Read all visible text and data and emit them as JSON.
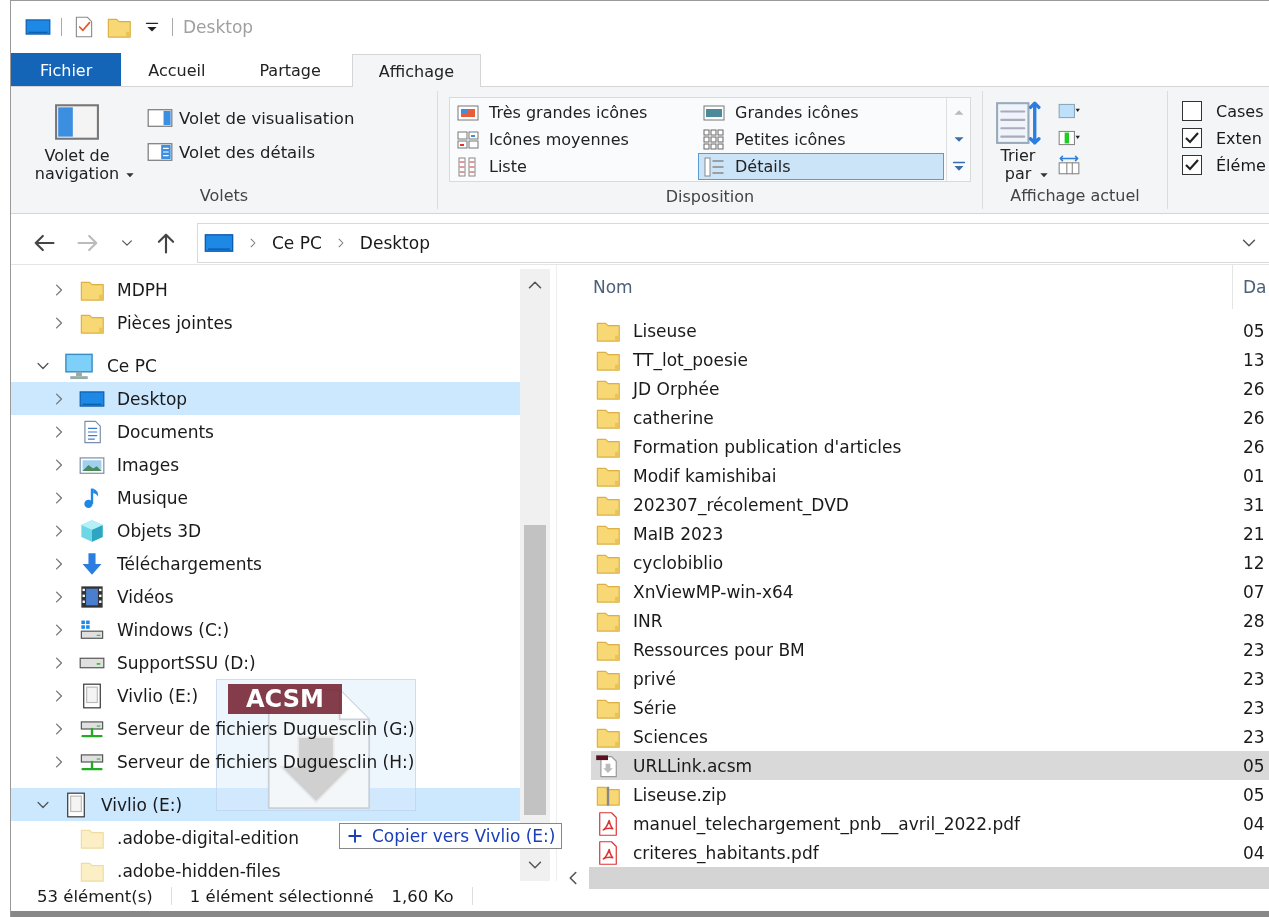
{
  "quick_access": {
    "title": "Desktop"
  },
  "ribbon_tabs": [
    {
      "label": "Fichier",
      "kind": "file",
      "selected": false
    },
    {
      "label": "Accueil",
      "kind": "tab",
      "selected": false
    },
    {
      "label": "Partage",
      "kind": "tab",
      "selected": false
    },
    {
      "label": "Affichage",
      "kind": "tab",
      "selected": true
    }
  ],
  "ribbon": {
    "panes": {
      "label": "Volets",
      "nav_button": "Volet de navigation",
      "items": [
        "Volet de visualisation",
        "Volet des détails"
      ]
    },
    "layout": {
      "label": "Disposition",
      "options": [
        {
          "label": "Très grandes icônes",
          "selected": false
        },
        {
          "label": "Grandes icônes",
          "selected": false
        },
        {
          "label": "Icônes moyennes",
          "selected": false
        },
        {
          "label": "Petites icônes",
          "selected": false
        },
        {
          "label": "Liste",
          "selected": false
        },
        {
          "label": "Détails",
          "selected": true
        }
      ]
    },
    "current_view": {
      "label": "Affichage actuel",
      "sort_button": "Trier par"
    },
    "show_hide": [
      {
        "label": "Cases",
        "checked": false
      },
      {
        "label": "Exten",
        "checked": true
      },
      {
        "label": "Éléme",
        "checked": true
      }
    ]
  },
  "address": {
    "crumbs": [
      "Ce PC",
      "Desktop"
    ]
  },
  "nav_tree": [
    {
      "kind": "offscreen",
      "children": [
        {
          "kind": "folder",
          "label": "MDPH",
          "expanded": false,
          "selected": false
        },
        {
          "kind": "folder",
          "label": "Pièces jointes",
          "expanded": false,
          "selected": false
        }
      ]
    },
    {
      "kind": "pc",
      "label": "Ce PC",
      "expanded": true,
      "selected": false,
      "children": [
        {
          "kind": "desktop",
          "label": "Desktop",
          "expanded": false,
          "selected": true
        },
        {
          "kind": "documents",
          "label": "Documents",
          "expanded": false,
          "selected": false
        },
        {
          "kind": "images",
          "label": "Images",
          "expanded": false,
          "selected": false
        },
        {
          "kind": "music",
          "label": "Musique",
          "expanded": false,
          "selected": false
        },
        {
          "kind": "cube",
          "label": "Objets 3D",
          "expanded": false,
          "selected": false
        },
        {
          "kind": "download",
          "label": "Téléchargements",
          "expanded": false,
          "selected": false
        },
        {
          "kind": "video",
          "label": "Vidéos",
          "expanded": false,
          "selected": false
        },
        {
          "kind": "system-drive",
          "label": "Windows (C:)",
          "expanded": false,
          "selected": false
        },
        {
          "kind": "drive",
          "label": "SupportSSU (D:)",
          "expanded": false,
          "selected": false
        },
        {
          "kind": "device",
          "label": "Vivlio (E:)",
          "expanded": false,
          "selected": false
        },
        {
          "kind": "network-drive",
          "label": "Serveur de fichiers Duguesclin (G:)",
          "expanded": false,
          "selected": false
        },
        {
          "kind": "network-drive",
          "label": "Serveur de fichiers Duguesclin (H:)",
          "expanded": false,
          "selected": false
        }
      ]
    },
    {
      "kind": "device",
      "label": "Vivlio (E:)",
      "expanded": true,
      "selected": true,
      "children": [
        {
          "kind": "faded-folder",
          "label": ".adobe-digital-edition",
          "selected": false
        },
        {
          "kind": "faded-folder",
          "label": ".adobe-hidden-files",
          "selected": false
        }
      ]
    }
  ],
  "files": {
    "columns": [
      "Nom",
      "Da"
    ],
    "rows": [
      {
        "kind": "folder",
        "name": "Liseuse",
        "date": "05",
        "selected": false
      },
      {
        "kind": "folder",
        "name": "TT_lot_poesie",
        "date": "13",
        "selected": false
      },
      {
        "kind": "folder",
        "name": "JD Orphée",
        "date": "26",
        "selected": false
      },
      {
        "kind": "folder",
        "name": "catherine",
        "date": "26",
        "selected": false
      },
      {
        "kind": "folder",
        "name": "Formation publication d'articles",
        "date": "26",
        "selected": false
      },
      {
        "kind": "folder",
        "name": "Modif kamishibai",
        "date": "01",
        "selected": false
      },
      {
        "kind": "folder",
        "name": "202307_récolement_DVD",
        "date": "31",
        "selected": false
      },
      {
        "kind": "folder",
        "name": "MaIB 2023",
        "date": "21",
        "selected": false
      },
      {
        "kind": "folder",
        "name": "cyclobiblio",
        "date": "12",
        "selected": false
      },
      {
        "kind": "folder",
        "name": "XnViewMP-win-x64",
        "date": "07",
        "selected": false
      },
      {
        "kind": "folder",
        "name": "INR",
        "date": "28",
        "selected": false
      },
      {
        "kind": "folder",
        "name": "Ressources pour BM",
        "date": "23",
        "selected": false
      },
      {
        "kind": "folder",
        "name": "privé",
        "date": "23",
        "selected": false
      },
      {
        "kind": "folder",
        "name": "Série",
        "date": "23",
        "selected": false
      },
      {
        "kind": "folder",
        "name": "Sciences",
        "date": "23",
        "selected": false
      },
      {
        "kind": "acsm",
        "name": "URLLink.acsm",
        "date": "05",
        "selected": true
      },
      {
        "kind": "zip",
        "name": "Liseuse.zip",
        "date": "05",
        "selected": false
      },
      {
        "kind": "pdf",
        "name": "manuel_telechargement_pnb__avril_2022.pdf",
        "date": "04",
        "selected": false
      },
      {
        "kind": "pdf",
        "name": "criteres_habitants.pdf",
        "date": "04",
        "selected": false
      }
    ]
  },
  "drag": {
    "badge": "ACSM",
    "tooltip": "Copier vers Vivlio (E:)"
  },
  "status_bar": [
    "53 élément(s)",
    "1 élément sélectionné",
    "1,60 Ko"
  ]
}
